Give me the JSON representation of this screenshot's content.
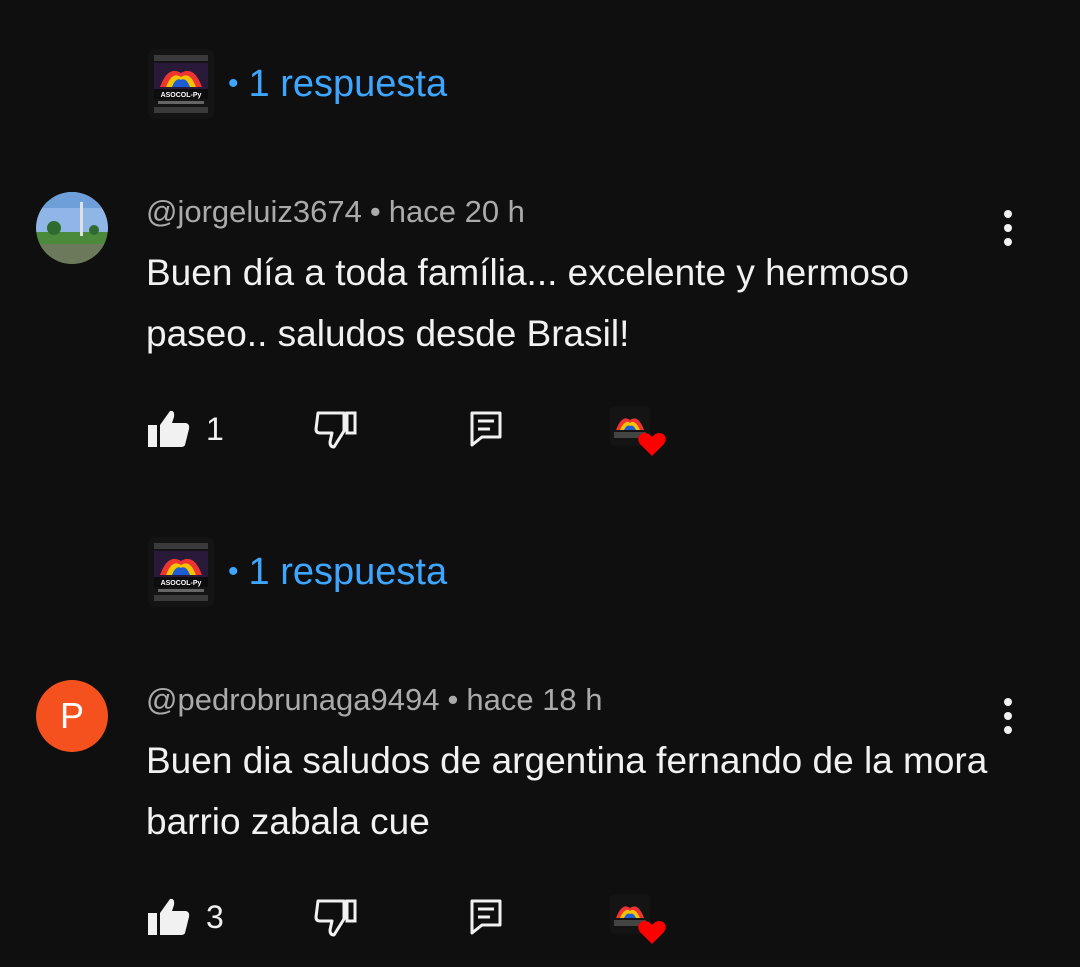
{
  "reply_links": [
    {
      "label": "1 respuesta",
      "dot": "•"
    },
    {
      "label": "1 respuesta",
      "dot": "•"
    }
  ],
  "comments": [
    {
      "author": "@jorgeluiz3674",
      "time": "hace 20 h",
      "separator": "•",
      "text": "Buen día a toda família... excelente y hermoso paseo.. saludos desde Brasil!",
      "likes": "1",
      "avatar_type": "photo"
    },
    {
      "author": "@pedrobrunaga9494",
      "time": "hace 18 h",
      "separator": "•",
      "text": "Buen dia saludos de argentina fernando de la mora barrio zabala cue",
      "likes": "3",
      "avatar_type": "letter",
      "avatar_letter": "P"
    }
  ],
  "channel_logo_text": "ASOCOL-Py",
  "colors": {
    "background": "#0f0f0f",
    "link": "#3ea6ff",
    "meta": "#aaaaaa",
    "text": "#f1f1f1",
    "avatar_letter_bg": "#f4511e",
    "heart": "#ff0000"
  },
  "icons": {
    "like": "thumb-up-icon",
    "dislike": "thumb-down-icon",
    "reply": "comment-icon",
    "more": "more-vert-icon",
    "creator_heart": "heart-icon"
  }
}
